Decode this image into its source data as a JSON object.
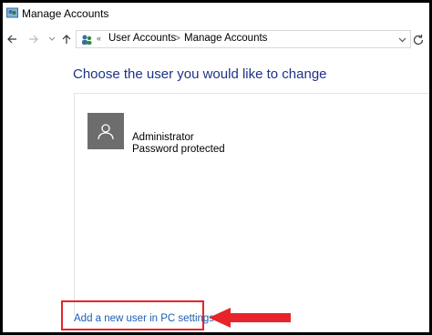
{
  "window": {
    "title": "Manage Accounts",
    "icon": "control-panel-users-icon"
  },
  "nav": {
    "back_icon": "back-arrow-icon",
    "forward_icon": "forward-arrow-icon",
    "up_icon": "up-arrow-icon",
    "address": {
      "icon": "user-accounts-icon",
      "overflow": "«",
      "crumbs": [
        "User Accounts",
        "Manage Accounts"
      ],
      "separator": ">",
      "dropdown_icon": "chevron-down-icon"
    },
    "refresh_icon": "refresh-icon"
  },
  "main": {
    "heading": "Choose the user you would like to change",
    "accounts": [
      {
        "name": "Administrator",
        "status": "Password protected",
        "avatar_icon": "user-silhouette-icon"
      }
    ],
    "add_user_link": "Add a new user in PC settings"
  },
  "annotation": {
    "highlight_color": "#e8232a",
    "arrow_icon": "red-left-arrow-icon"
  }
}
